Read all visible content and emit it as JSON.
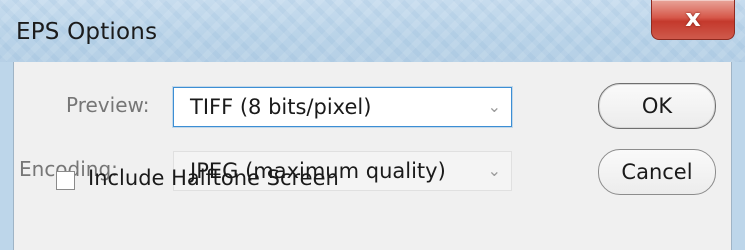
{
  "dialog": {
    "title": "EPS Options",
    "close_glyph": "x"
  },
  "preview": {
    "label": "Preview:",
    "value": "TIFF  (8 bits/pixel)",
    "chevron": "⌄"
  },
  "encoding": {
    "label": "Encoding:",
    "value": "JPEG  (maximum quality)",
    "chevron": "⌄",
    "enabled": false
  },
  "halftone": {
    "label": "Include Halftone Screen",
    "checked": false
  },
  "buttons": {
    "ok": "OK",
    "cancel": "Cancel"
  }
}
